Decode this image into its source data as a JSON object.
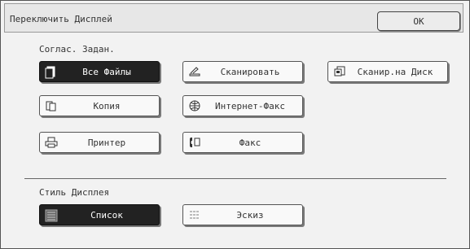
{
  "dialog": {
    "title": "Переключить Дисплей",
    "ok_label": "OK"
  },
  "job_section": {
    "label": "Соглас. Задан.",
    "buttons": [
      {
        "label": "Все Файлы",
        "active": true
      },
      {
        "label": "Сканировать",
        "active": false
      },
      {
        "label": "Сканир.на Диск",
        "active": false
      },
      {
        "label": "Копия",
        "active": false
      },
      {
        "label": "Интернет-Факс",
        "active": false
      },
      {
        "label": "Принтер",
        "active": false
      },
      {
        "label": "Факс",
        "active": false
      }
    ]
  },
  "display_section": {
    "label": "Стиль Дисплея",
    "buttons": [
      {
        "label": "Список",
        "active": true
      },
      {
        "label": "Эскиз",
        "active": false
      }
    ]
  },
  "colors": {
    "active_bg": "#222222",
    "border": "#555555"
  }
}
